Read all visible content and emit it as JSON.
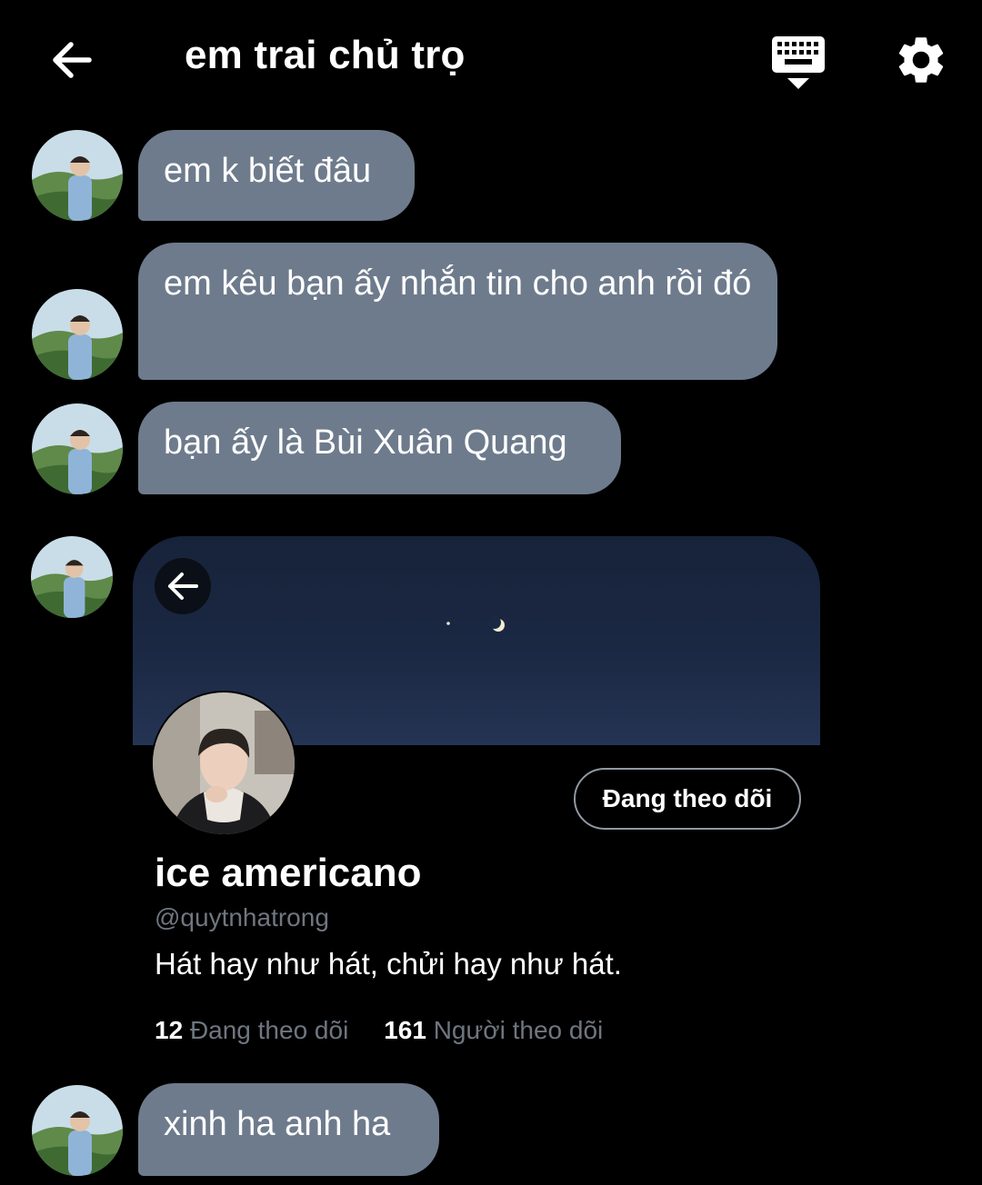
{
  "header": {
    "title": "em trai chủ trọ",
    "back_icon": "arrow-left-icon",
    "keyboard_icon": "keyboard-icon",
    "settings_icon": "gear-icon"
  },
  "messages": [
    {
      "text": "em k biết đâu"
    },
    {
      "text": "em kêu bạn ấy nhắn tin cho anh rồi đó"
    },
    {
      "text": "bạn ấy là Bùi Xuân Quang"
    },
    {
      "text": "xinh ha anh ha"
    }
  ],
  "profile_card": {
    "follow_button": "Đang theo dõi",
    "name": "ice americano",
    "handle": "@quytnhatrong",
    "bio": "Hát hay như hát, chửi hay như hát.",
    "following_count": "12",
    "following_label": "Đang theo dõi",
    "followers_count": "161",
    "followers_label": "Người theo dõi"
  },
  "colors": {
    "background": "#000000",
    "bubble": "#6e7b8c",
    "muted_text": "#6e7681"
  }
}
